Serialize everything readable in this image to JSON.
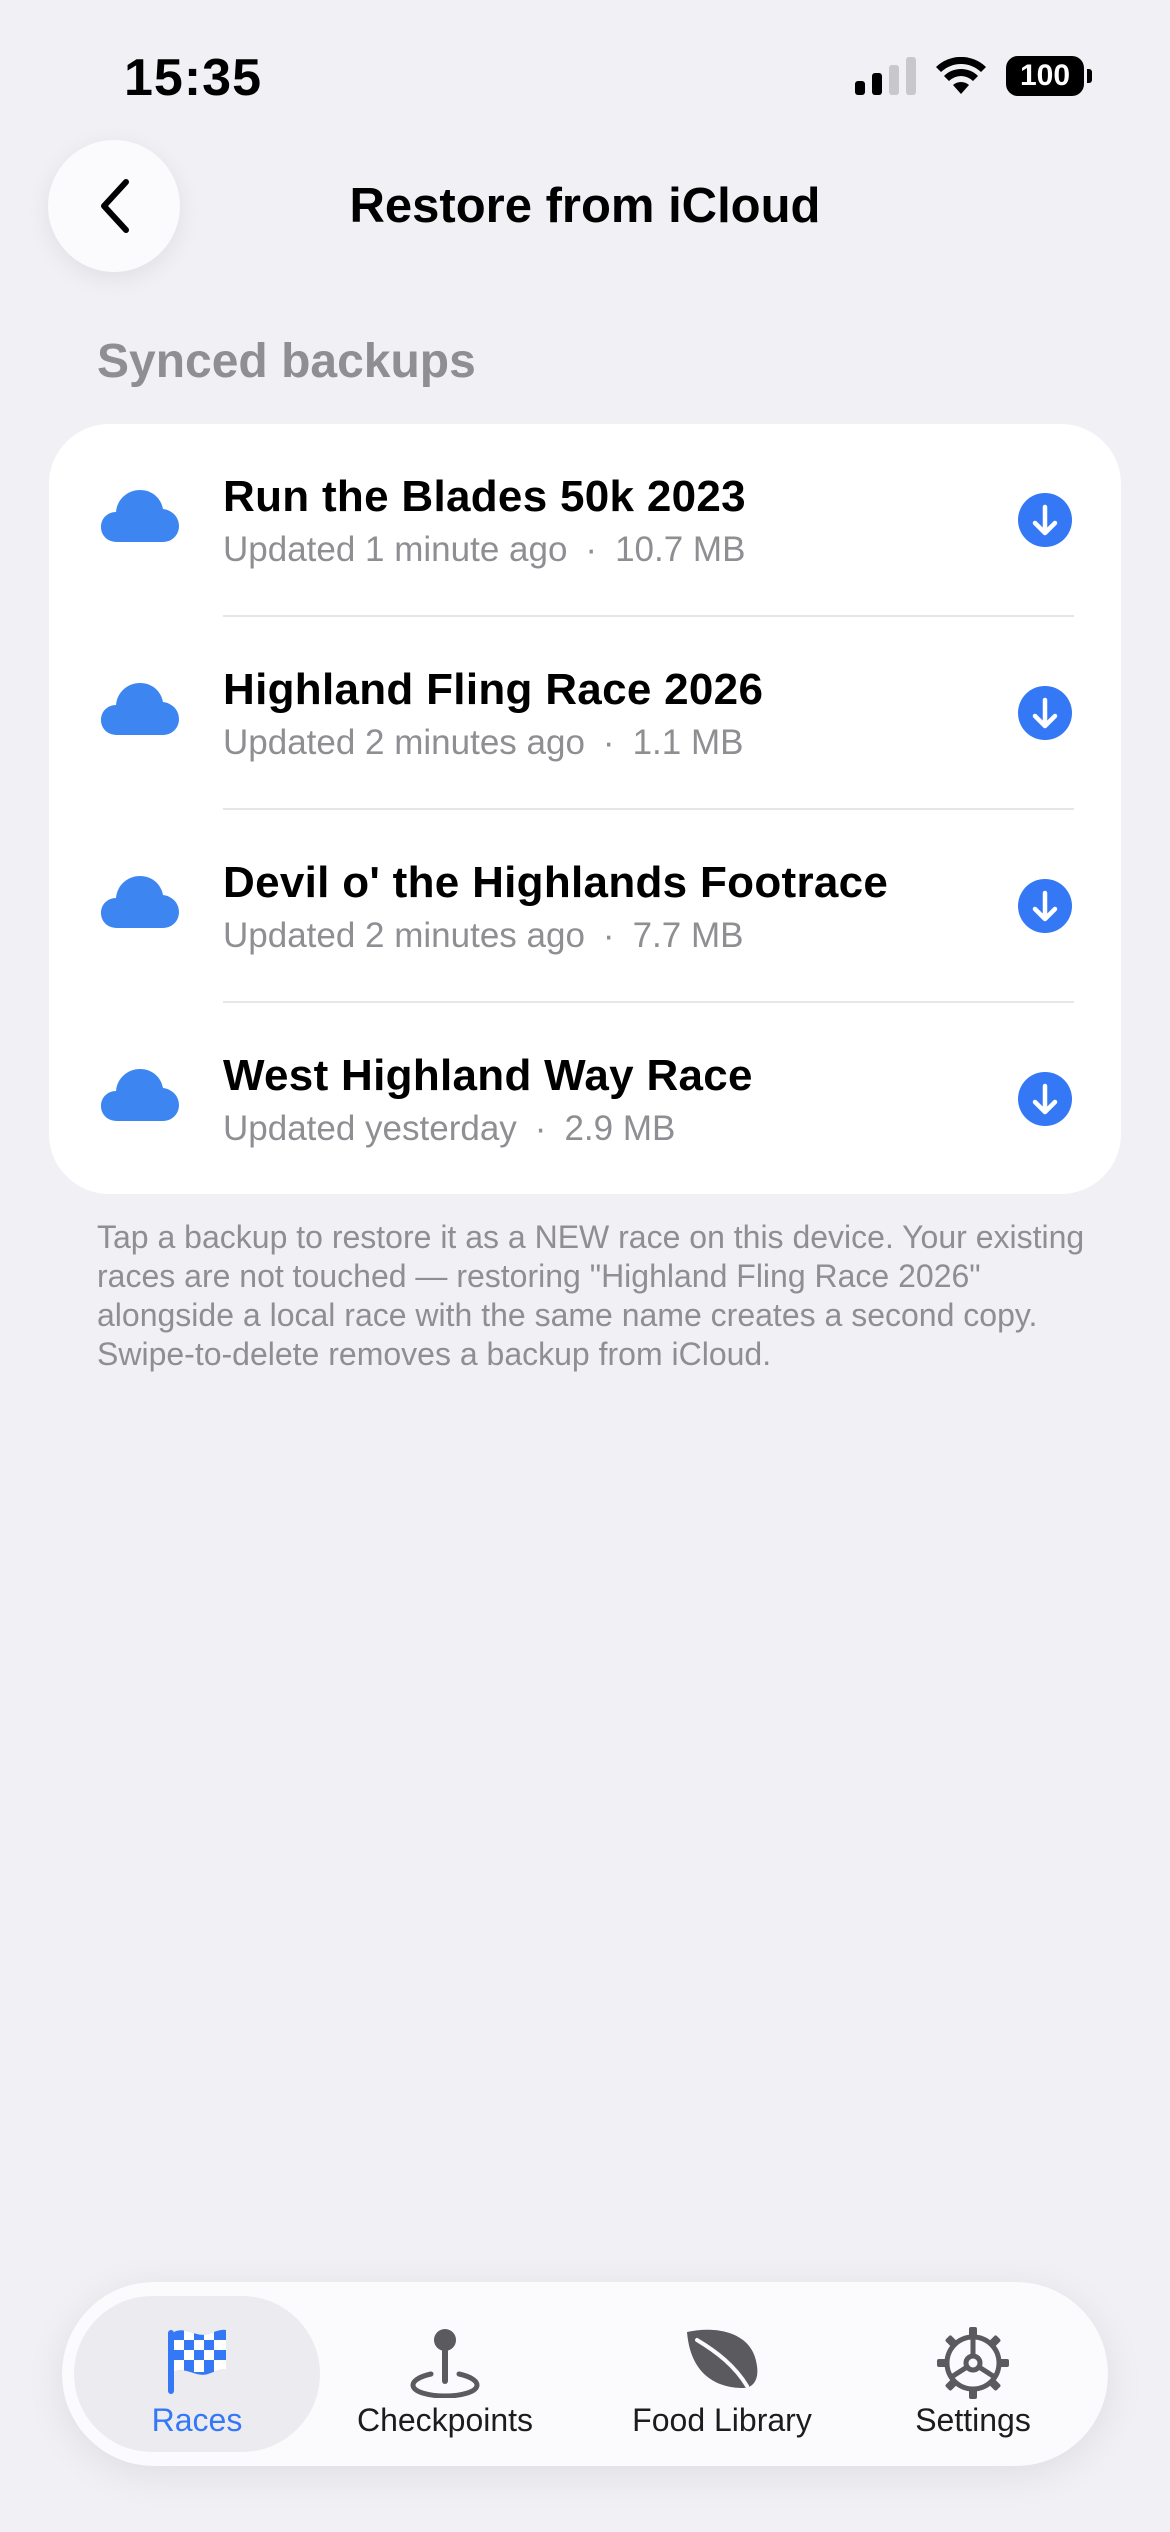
{
  "status_bar": {
    "time": "15:35",
    "battery": "100"
  },
  "nav": {
    "title": "Restore from iCloud"
  },
  "section_header": "Synced backups",
  "backups": [
    {
      "title": "Run the Blades 50k 2023",
      "updated": "Updated 1 minute ago",
      "size": "10.7 MB"
    },
    {
      "title": "Highland Fling Race 2026",
      "updated": "Updated 2 minutes ago",
      "size": "1.1 MB"
    },
    {
      "title": "Devil o' the Highlands Footrace",
      "updated": "Updated 2 minutes ago",
      "size": "7.7 MB"
    },
    {
      "title": "West Highland Way Race",
      "updated": "Updated yesterday",
      "size": "2.9 MB"
    }
  ],
  "separator": "·",
  "footnote": "Tap a backup to restore it as a NEW race on this device. Your existing races are not touched — restoring \"Highland Fling Race 2026\" alongside a local race with the same name creates a second copy. Swipe-to-delete removes a backup from iCloud.",
  "tabs": [
    {
      "label": "Races",
      "icon": "checkered-flag-icon",
      "active": true
    },
    {
      "label": "Checkpoints",
      "icon": "map-pin-icon",
      "active": false
    },
    {
      "label": "Food Library",
      "icon": "leaf-icon",
      "active": false
    },
    {
      "label": "Settings",
      "icon": "gear-icon",
      "active": false
    }
  ],
  "colors": {
    "accent": "#3478f6",
    "background": "#f0f0f5",
    "secondary_text": "#8e8e93"
  }
}
